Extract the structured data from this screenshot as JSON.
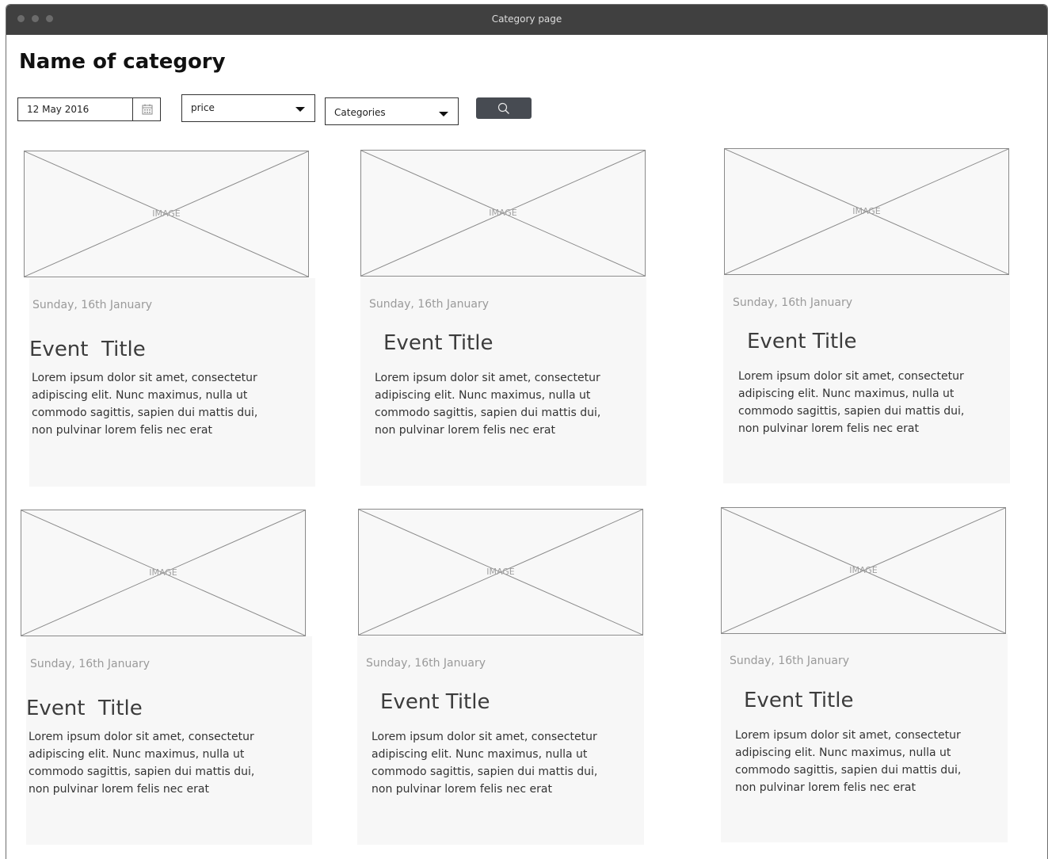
{
  "window": {
    "title": "Category page"
  },
  "page": {
    "heading": "Name of category"
  },
  "filters": {
    "date_value": "12 May 2016",
    "price_select": "price",
    "category_select": "Categories"
  },
  "icons": {
    "calendar": "calendar-icon",
    "caret": "caret-down-icon",
    "search": "search-icon",
    "window_dots": "window-control-dots"
  },
  "colors": {
    "titlebar": "#404040",
    "search_button": "#474b52",
    "card_background": "#f7f7f7"
  },
  "cards": [
    {
      "image_label": "IMAGE",
      "date": "Sunday, 16th January",
      "title": "Event  Title",
      "description": "Lorem ipsum dolor sit amet, consectetur adipiscing elit. Nunc maximus, nulla ut commodo sagittis, sapien dui mattis dui, non pulvinar lorem felis nec erat"
    },
    {
      "image_label": "IMAGE",
      "date": "Sunday, 16th January",
      "title": "Event Title",
      "description": "Lorem ipsum dolor sit amet, consectetur adipiscing elit. Nunc maximus, nulla ut commodo sagittis, sapien dui mattis dui, non pulvinar lorem felis nec erat"
    },
    {
      "image_label": "IMAGE",
      "date": "Sunday, 16th January",
      "title": "Event Title",
      "description": "Lorem ipsum dolor sit amet, consectetur adipiscing elit. Nunc maximus, nulla ut commodo sagittis, sapien dui mattis dui, non pulvinar lorem felis nec erat"
    },
    {
      "image_label": "IMAGE",
      "date": "Sunday, 16th January",
      "title": "Event  Title",
      "description": "Lorem ipsum dolor sit amet, consectetur adipiscing elit. Nunc maximus, nulla ut commodo sagittis, sapien dui mattis dui, non pulvinar lorem felis nec erat"
    },
    {
      "image_label": "IMAGE",
      "date": "Sunday, 16th January",
      "title": "Event Title",
      "description": "Lorem ipsum dolor sit amet, consectetur adipiscing elit. Nunc maximus, nulla ut commodo sagittis, sapien dui mattis dui, non pulvinar lorem felis nec erat"
    },
    {
      "image_label": "IMAGE",
      "date": "Sunday, 16th January",
      "title": "Event Title",
      "description": "Lorem ipsum dolor sit amet, consectetur adipiscing elit. Nunc maximus, nulla ut commodo sagittis, sapien dui mattis dui, non pulvinar lorem felis nec erat"
    }
  ]
}
